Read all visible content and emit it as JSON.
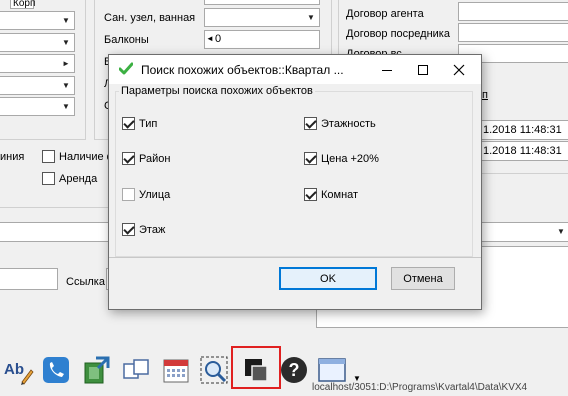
{
  "background": {
    "left": {
      "tab_label": "Корп",
      "checkboxes": [
        {
          "label": "Наличие ф",
          "checked": false
        },
        {
          "label": "Аренда",
          "checked": false
        }
      ],
      "partial_label": "иния",
      "link_label": "Ссылка"
    },
    "middle": {
      "label_top": "Сан. узел, ванная",
      "label_balcony": "Балконы",
      "balcony_value": "0",
      "label_b": "Б",
      "label_l": "Л",
      "label_s": "С"
    },
    "right": {
      "label_agent": "Договор агента",
      "label_mediator": "Договор посредника",
      "label_partial": "Договор вс",
      "partial_n": "п",
      "date1": "1.2018 11:48:31",
      "date2": "1.2018 11:48:31"
    }
  },
  "dialog": {
    "title": "Поиск похожих объектов::Квартал ...",
    "group_title": "Параметры поиска похожих объектов",
    "options": [
      {
        "id": "type",
        "label": "Тип",
        "checked": true
      },
      {
        "id": "district",
        "label": "Район",
        "checked": true
      },
      {
        "id": "street",
        "label": "Улица",
        "checked": false
      },
      {
        "id": "floor",
        "label": "Этаж",
        "checked": true
      },
      {
        "id": "floors",
        "label": "Этажность",
        "checked": true
      },
      {
        "id": "price",
        "label": "Цена +20%",
        "checked": true
      },
      {
        "id": "rooms",
        "label": "Комнат",
        "checked": true
      }
    ],
    "ok_label": "OK",
    "cancel_label": "Отмена"
  },
  "toolbar": {
    "items": [
      "ab-pencil-icon",
      "phone-icon",
      "export-icon",
      "copy-windows-icon",
      "calendar-icon",
      "search-dashed-icon",
      "similar-objects-icon",
      "help-icon",
      "window-icon",
      "chevron-down-icon"
    ],
    "status_path": "localhost/3051:D:\\Programs\\Kvartal4\\Data\\KVX4"
  },
  "colors": {
    "highlight": "#e02020",
    "default_button_border": "#0078d7",
    "check_icon": "#3cb043"
  }
}
